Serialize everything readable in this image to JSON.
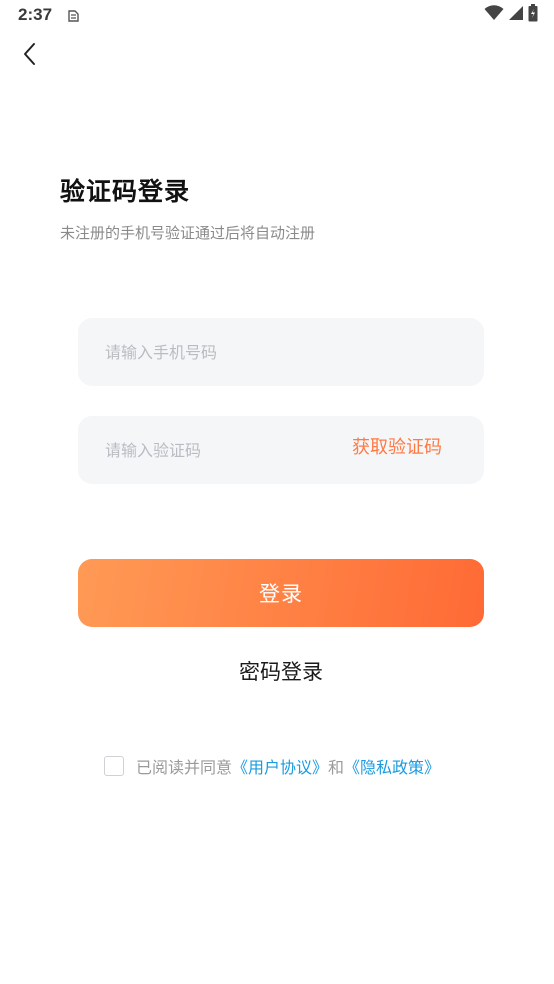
{
  "status_bar": {
    "time": "2:37"
  },
  "header": {
    "back_icon": "chevron-left-icon"
  },
  "title": "验证码登录",
  "subtitle": "未注册的手机号验证通过后将自动注册",
  "phone_field": {
    "placeholder": "请输入手机号码",
    "value": ""
  },
  "code_field": {
    "placeholder": "请输入验证码",
    "value": "",
    "get_code_label": "获取验证码"
  },
  "login_button": "登录",
  "password_login": "密码登录",
  "agreement": {
    "checked": false,
    "prefix": "已阅读并同意",
    "user_agreement": "《用户协议》",
    "and": "和",
    "privacy_policy": "《隐私政策》"
  },
  "colors": {
    "accent": "#ff7a45",
    "button_gradient_start": "#ff9a55",
    "button_gradient_end": "#ff6a35",
    "link": "#1a9be0",
    "input_bg": "#f5f6f8"
  }
}
